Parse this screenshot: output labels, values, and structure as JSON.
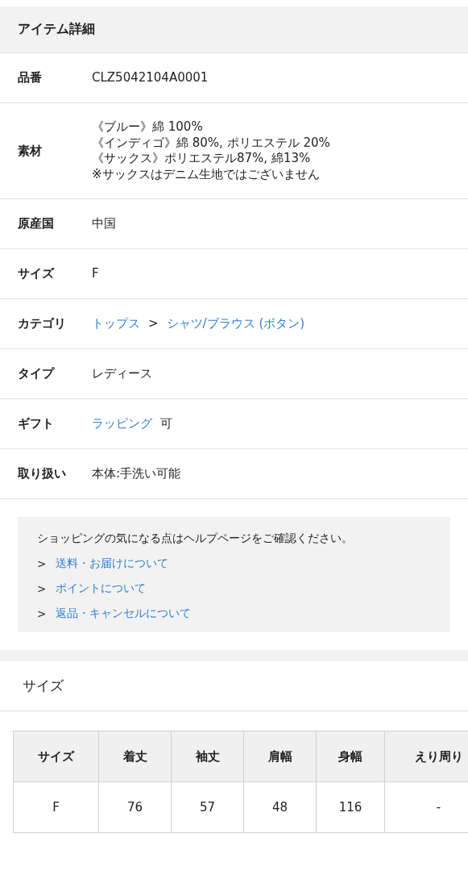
{
  "header": {
    "title": "アイテム詳細"
  },
  "details": [
    {
      "label": "品番",
      "value": [
        {
          "kind": "text",
          "text": "CLZ5042104A0001"
        }
      ]
    },
    {
      "label": "素材",
      "value": [
        {
          "kind": "text",
          "text": "《ブルー》綿 100%\n《インディゴ》綿 80%, ポリエステル 20%\n《サックス》ポリエステル87%, 綿13%\n※サックスはデニム生地ではございません"
        }
      ]
    },
    {
      "label": "原産国",
      "value": [
        {
          "kind": "text",
          "text": "中国"
        }
      ]
    },
    {
      "label": "サイズ",
      "value": [
        {
          "kind": "text",
          "text": "F"
        }
      ]
    },
    {
      "label": "カテゴリ",
      "value": [
        {
          "kind": "link",
          "text": "トップス"
        },
        {
          "kind": "separator",
          "text": ">"
        },
        {
          "kind": "link",
          "text": "シャツ/ブラウス (ボタン)"
        }
      ]
    },
    {
      "label": "タイプ",
      "value": [
        {
          "kind": "text",
          "text": "レディース"
        }
      ]
    },
    {
      "label": "ギフト",
      "value": [
        {
          "kind": "link",
          "text": "ラッピング"
        },
        {
          "kind": "text",
          "text": "可"
        }
      ]
    },
    {
      "label": "取り扱い",
      "value": [
        {
          "kind": "text",
          "text": "本体:手洗い可能"
        }
      ]
    }
  ],
  "help": {
    "message": "ショッピングの気になる点はヘルプページをご確認ください。",
    "links": [
      {
        "marker": ">",
        "text": "送料・お届けについて"
      },
      {
        "marker": ">",
        "text": "ポイントについて"
      },
      {
        "marker": ">",
        "text": "返品・キャンセルについて"
      }
    ]
  },
  "size_section": {
    "title": "サイズ",
    "table": {
      "columns": [
        "サイズ",
        "着丈",
        "袖丈",
        "肩幅",
        "身幅",
        "えり周り"
      ],
      "rows": [
        [
          "F",
          "76",
          "57",
          "48",
          "116",
          "-"
        ]
      ]
    }
  }
}
